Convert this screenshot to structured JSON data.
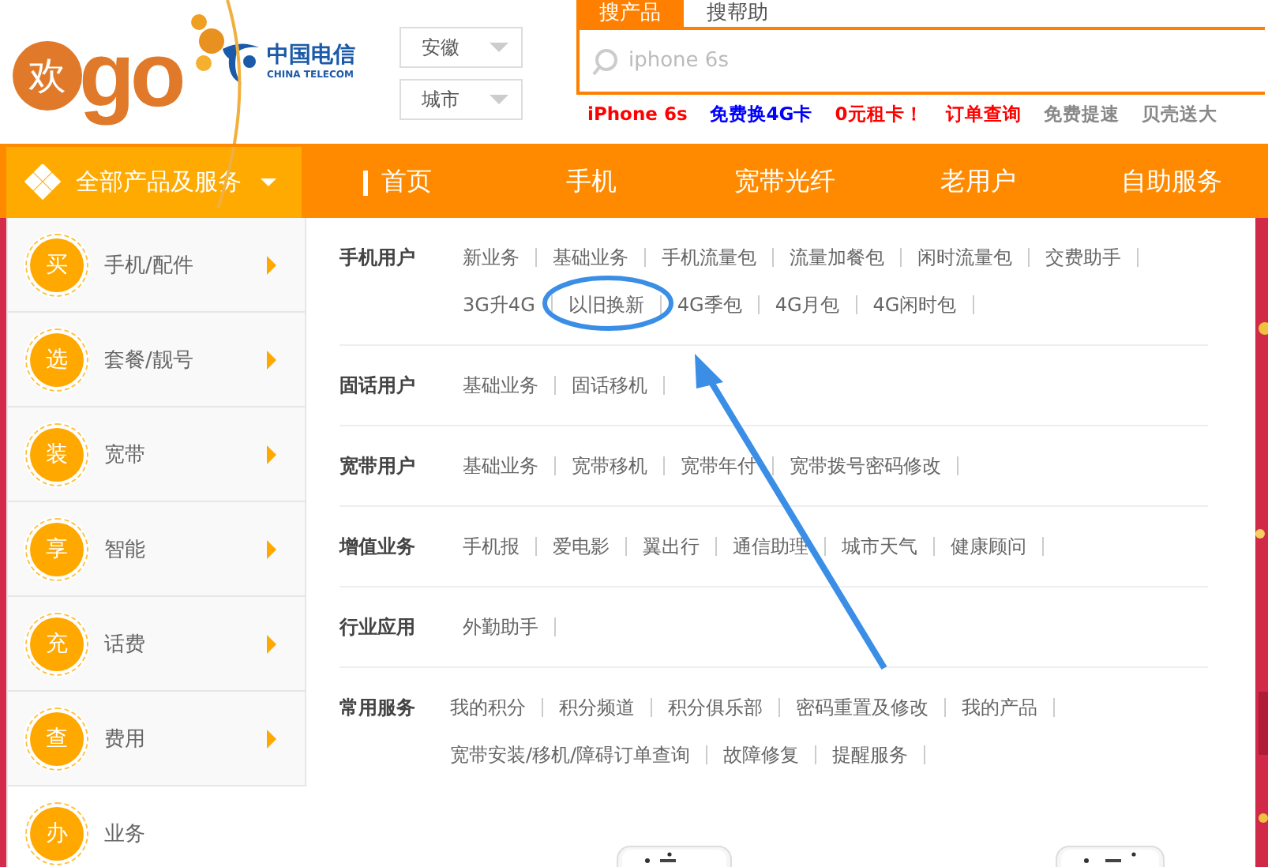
{
  "logo": {
    "badge": "欢",
    "word": "go"
  },
  "partner": {
    "name": "中国电信",
    "subtitle": "CHINA TELECOM"
  },
  "region": [
    {
      "value": "安徽"
    },
    {
      "value": "城市"
    }
  ],
  "search": {
    "tabs": [
      {
        "label": "搜产品",
        "selected": true
      },
      {
        "label": "搜帮助",
        "selected": false
      }
    ],
    "placeholder": "iphone 6s"
  },
  "quick_links": [
    {
      "label": "iPhone 6s",
      "color": "#ff0000"
    },
    {
      "label": "免费换4G卡",
      "color": "#0000ff"
    },
    {
      "label": "0元租卡！",
      "color": "#ff0000"
    },
    {
      "label": "订单查询",
      "color": "#ff0000"
    },
    {
      "label": "免费提速",
      "color": "#888888"
    },
    {
      "label": "贝壳送大",
      "color": "#888888"
    }
  ],
  "all_products": {
    "label": "全部产品及服务"
  },
  "nav": [
    {
      "label": "首页",
      "marker": true
    },
    {
      "label": "手机",
      "marker": false
    },
    {
      "label": "宽带光纤",
      "marker": false
    },
    {
      "label": "老用户",
      "marker": false
    },
    {
      "label": "自助服务",
      "marker": false
    }
  ],
  "sidebar": [
    {
      "badge": "买",
      "label": "手机/配件",
      "selected": false
    },
    {
      "badge": "选",
      "label": "套餐/靓号",
      "selected": false
    },
    {
      "badge": "装",
      "label": "宽带",
      "selected": false
    },
    {
      "badge": "享",
      "label": "智能",
      "selected": false
    },
    {
      "badge": "充",
      "label": "话费",
      "selected": false
    },
    {
      "badge": "查",
      "label": "费用",
      "selected": false
    },
    {
      "badge": "办",
      "label": "业务",
      "selected": true
    }
  ],
  "menu": [
    {
      "title": "手机用户",
      "lines": [
        [
          "新业务",
          "基础业务",
          "手机流量包",
          "流量加餐包",
          "闲时流量包",
          "交费助手"
        ],
        [
          "3G升4G",
          "以旧换新",
          "4G季包",
          "4G月包",
          "4G闲时包"
        ]
      ]
    },
    {
      "title": "固话用户",
      "lines": [
        [
          "基础业务",
          "固话移机"
        ]
      ]
    },
    {
      "title": "宽带用户",
      "lines": [
        [
          "基础业务",
          "宽带移机",
          "宽带年付",
          "宽带拨号密码修改"
        ]
      ]
    },
    {
      "title": "增值业务",
      "lines": [
        [
          "手机报",
          "爱电影",
          "翼出行",
          "通信助理",
          "城市天气",
          "健康顾问"
        ]
      ]
    },
    {
      "title": "行业应用",
      "lines": [
        [
          "外勤助手"
        ]
      ]
    },
    {
      "title": "常用服务",
      "lines": [
        [
          "我的积分",
          "积分频道",
          "积分俱乐部",
          "密码重置及修改",
          "我的产品"
        ],
        [
          "宽带安装/移机/障碍订单查询",
          "故障修复",
          "提醒服务"
        ]
      ]
    }
  ],
  "annotations": {
    "ellipse": true,
    "arrow": true
  }
}
